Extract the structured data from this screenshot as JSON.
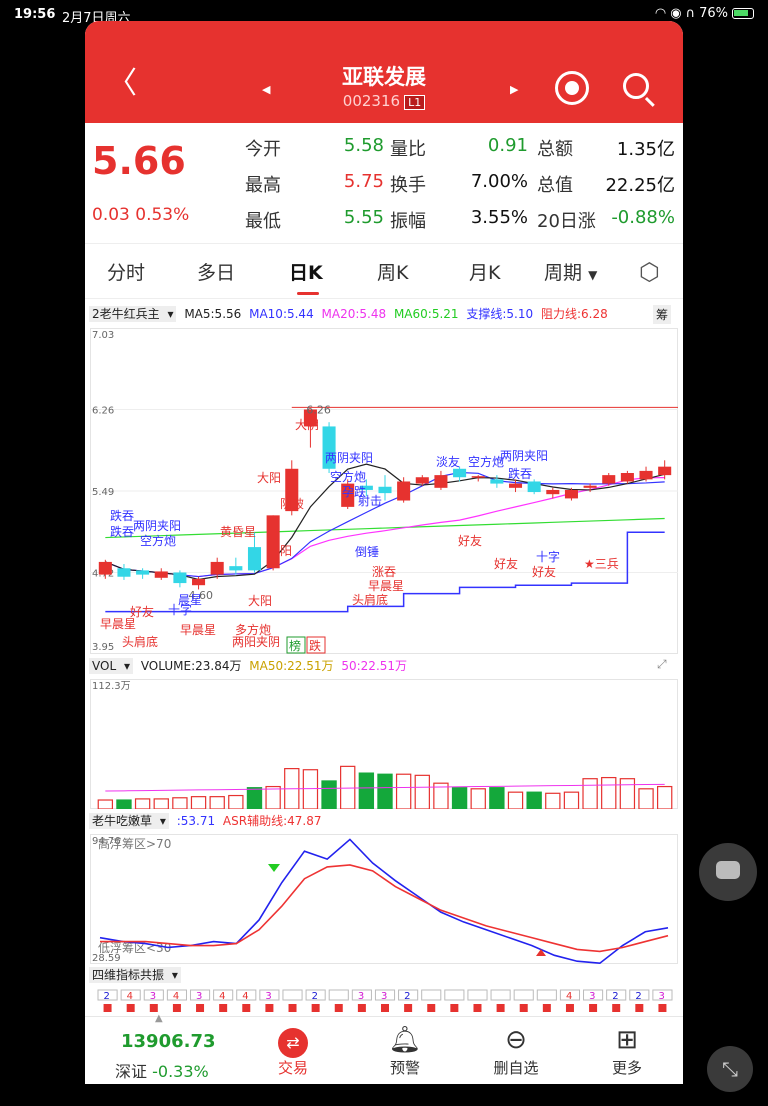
{
  "status": {
    "time": "19:56",
    "date": "2月7日周六",
    "battery": "76%"
  },
  "header": {
    "title": "亚联发展",
    "code": "002316",
    "level": "L1"
  },
  "quote": {
    "price": "5.66",
    "change": "0.03",
    "change_pct": "0.53%",
    "fields": [
      {
        "label": "今开",
        "value": "5.58",
        "color": "green"
      },
      {
        "label": "量比",
        "value": "0.91",
        "color": "green"
      },
      {
        "label": "总额",
        "value": "1.35亿",
        "color": "black"
      },
      {
        "label": "最高",
        "value": "5.75",
        "color": "red"
      },
      {
        "label": "换手",
        "value": "7.00%",
        "color": "black"
      },
      {
        "label": "总值",
        "value": "22.25亿",
        "color": "black"
      },
      {
        "label": "最低",
        "value": "5.55",
        "color": "green"
      },
      {
        "label": "振幅",
        "value": "3.55%",
        "color": "black"
      },
      {
        "label": "20日涨",
        "value": "-0.88%",
        "color": "green"
      }
    ]
  },
  "tabs": [
    "分时",
    "多日",
    "日K",
    "周K",
    "月K",
    "周期"
  ],
  "main_indicator": {
    "name": "2老牛红兵主",
    "ma5": "MA5:5.56",
    "ma10": "MA10:5.44",
    "ma20": "MA20:5.48",
    "ma60": "MA60:5.21",
    "support": "支撑线:5.10",
    "resist": "阻力线:6.28",
    "badge": "筹"
  },
  "price_axis": [
    "7.03",
    "6.26",
    "5.49",
    "4.72",
    "3.95"
  ],
  "colors": {
    "up": "#e6322f",
    "down": "#14a83b",
    "down_alt": "#33d6e6",
    "ma5": "#222222",
    "ma10": "#3333ff",
    "ma20": "#ff33ff",
    "ma60": "#33dd33"
  },
  "chart_data": [
    {
      "type": "candlestick",
      "title": "",
      "ylim": [
        3.95,
        7.03
      ],
      "candles": [
        {
          "o": 4.7,
          "c": 4.82,
          "h": 4.84,
          "l": 4.66,
          "t": "up"
        },
        {
          "o": 4.76,
          "c": 4.68,
          "h": 4.8,
          "l": 4.65,
          "t": "dn2"
        },
        {
          "o": 4.74,
          "c": 4.7,
          "h": 4.76,
          "l": 4.66,
          "t": "dn2"
        },
        {
          "o": 4.73,
          "c": 4.67,
          "h": 4.76,
          "l": 4.65,
          "t": "up"
        },
        {
          "o": 4.72,
          "c": 4.62,
          "h": 4.74,
          "l": 4.58,
          "t": "dn2"
        },
        {
          "o": 4.66,
          "c": 4.6,
          "h": 4.68,
          "l": 4.56,
          "t": "up"
        },
        {
          "o": 4.7,
          "c": 4.82,
          "h": 4.86,
          "l": 4.66,
          "t": "up"
        },
        {
          "o": 4.78,
          "c": 4.74,
          "h": 4.86,
          "l": 4.7,
          "t": "dn2"
        },
        {
          "o": 4.96,
          "c": 4.74,
          "h": 5.1,
          "l": 4.72,
          "t": "dn2"
        },
        {
          "o": 4.76,
          "c": 5.26,
          "h": 5.26,
          "l": 4.74,
          "t": "up"
        },
        {
          "o": 5.3,
          "c": 5.7,
          "h": 5.78,
          "l": 5.26,
          "t": "up"
        },
        {
          "o": 6.1,
          "c": 6.26,
          "h": 6.26,
          "l": 5.9,
          "t": "up"
        },
        {
          "o": 6.1,
          "c": 5.7,
          "h": 6.14,
          "l": 5.66,
          "t": "dn2"
        },
        {
          "o": 5.34,
          "c": 5.56,
          "h": 5.6,
          "l": 5.32,
          "t": "up"
        },
        {
          "o": 5.54,
          "c": 5.5,
          "h": 5.6,
          "l": 5.44,
          "t": "dn2"
        },
        {
          "o": 5.53,
          "c": 5.47,
          "h": 5.64,
          "l": 5.4,
          "t": "dn2"
        },
        {
          "o": 5.4,
          "c": 5.58,
          "h": 5.62,
          "l": 5.38,
          "t": "up"
        },
        {
          "o": 5.56,
          "c": 5.62,
          "h": 5.64,
          "l": 5.54,
          "t": "up"
        },
        {
          "o": 5.52,
          "c": 5.64,
          "h": 5.68,
          "l": 5.5,
          "t": "up"
        },
        {
          "o": 5.7,
          "c": 5.62,
          "h": 5.72,
          "l": 5.58,
          "t": "dn2"
        },
        {
          "o": 5.63,
          "c": 5.62,
          "h": 5.64,
          "l": 5.58,
          "t": "up"
        },
        {
          "o": 5.6,
          "c": 5.56,
          "h": 5.64,
          "l": 5.52,
          "t": "dn2"
        },
        {
          "o": 5.56,
          "c": 5.52,
          "h": 5.6,
          "l": 5.48,
          "t": "up"
        },
        {
          "o": 5.58,
          "c": 5.48,
          "h": 5.6,
          "l": 5.46,
          "t": "dn2"
        },
        {
          "o": 5.5,
          "c": 5.46,
          "h": 5.52,
          "l": 5.42,
          "t": "up"
        },
        {
          "o": 5.42,
          "c": 5.5,
          "h": 5.52,
          "l": 5.4,
          "t": "up"
        },
        {
          "o": 5.52,
          "c": 5.54,
          "h": 5.56,
          "l": 5.48,
          "t": "up"
        },
        {
          "o": 5.56,
          "c": 5.64,
          "h": 5.66,
          "l": 5.54,
          "t": "up"
        },
        {
          "o": 5.58,
          "c": 5.66,
          "h": 5.68,
          "l": 5.56,
          "t": "up"
        },
        {
          "o": 5.6,
          "c": 5.68,
          "h": 5.72,
          "l": 5.58,
          "t": "up"
        },
        {
          "o": 5.64,
          "c": 5.72,
          "h": 5.78,
          "l": 5.6,
          "t": "up"
        }
      ]
    },
    {
      "type": "bar",
      "title": "VOLUME:23.84万",
      "ylim": [
        0,
        112.3
      ],
      "values": [
        8,
        8,
        9,
        9,
        10,
        11,
        11,
        12,
        19,
        20,
        36,
        35,
        25,
        38,
        32,
        31,
        31,
        30,
        23,
        19,
        18,
        19,
        15,
        15,
        14,
        15,
        27,
        28,
        27,
        18,
        20
      ],
      "colors": [
        "up",
        "dn",
        "up",
        "up",
        "up",
        "up",
        "up",
        "up",
        "dn",
        "up",
        "up",
        "up",
        "dn",
        "up",
        "dn",
        "dn",
        "up",
        "up",
        "up",
        "dn",
        "up",
        "dn",
        "up",
        "dn",
        "up",
        "up",
        "up",
        "up",
        "up",
        "up",
        "up"
      ]
    },
    {
      "type": "line",
      "title": "ASR",
      "ylim": [
        28.59,
        94.76
      ],
      "series": [
        {
          "name": "ASR",
          "values": [
            42,
            40,
            39,
            37,
            38,
            40,
            39,
            51,
            70,
            86,
            82,
            92,
            80,
            71,
            63,
            55,
            50,
            46,
            42,
            38,
            33,
            30,
            29,
            38,
            45,
            47
          ]
        },
        {
          "name": "ASR辅助线",
          "values": [
            40,
            40,
            40,
            39,
            38,
            38,
            39,
            46,
            58,
            72,
            78,
            79,
            76,
            68,
            62,
            56,
            52,
            48,
            45,
            42,
            39,
            36,
            35,
            37,
            40,
            43
          ]
        }
      ]
    }
  ],
  "annotations": {
    "high": "6.26",
    "low": "4.60",
    "red_labels": [
      {
        "t": "大阴"
      },
      {
        "t": "二"
      },
      {
        "t": "阴破"
      },
      {
        "t": "大阳"
      },
      {
        "t": "一阳"
      },
      {
        "t": "大阳"
      },
      {
        "t": "好友"
      },
      {
        "t": "早晨星"
      },
      {
        "t": "头肩底"
      },
      {
        "t": "早晨星"
      },
      {
        "t": "多方炮"
      },
      {
        "t": "两阳夹阴"
      },
      {
        "t": "黄昏星"
      },
      {
        "t": "好友"
      },
      {
        "t": "涨吞"
      },
      {
        "t": "早晨星"
      },
      {
        "t": "头肩底"
      },
      {
        "t": "好友"
      },
      {
        "t": "好友"
      },
      {
        "t": "★三兵"
      }
    ],
    "blue_labels": [
      {
        "t": "两阴夹阳"
      },
      {
        "t": "空方炮"
      },
      {
        "t": "孕跌"
      },
      {
        "t": "射击"
      },
      {
        "t": "跌吞"
      },
      {
        "t": "两阴夹阳"
      },
      {
        "t": "跌吞"
      },
      {
        "t": "空方炮"
      },
      {
        "t": "倒锤"
      },
      {
        "t": "淡友"
      },
      {
        "t": "空方炮"
      },
      {
        "t": "两阴夹阳"
      },
      {
        "t": "跌吞"
      },
      {
        "t": "十字"
      },
      {
        "t": "十字"
      },
      {
        "t": "晨星"
      }
    ],
    "boxes": [
      "榜",
      "跌"
    ]
  },
  "volume_indicator": {
    "name": "VOL",
    "volume": "VOLUME:23.84万",
    "ma50": "MA50:22.51万",
    "v50": "50:22.51万",
    "axis_top": "112.3万"
  },
  "asr_indicator": {
    "name": "老牛吃嫩草",
    "asr": ":53.71",
    "aux": "ASR辅助线:47.87",
    "axis_top": "94.76",
    "axis_bottom": "28.59",
    "high_zone": "高浮筹区>70",
    "low_zone": "低浮筹区<30"
  },
  "resonance": {
    "name": "四维指标共振",
    "digits": [
      "2",
      "4",
      "3",
      "4",
      "3",
      "4",
      "4",
      "3",
      "",
      "2",
      "",
      "3",
      "3",
      "2",
      "",
      "",
      "",
      "",
      "",
      "",
      "4",
      "3",
      "2",
      "2",
      "3"
    ]
  },
  "bottom_nav": {
    "index_value": "13906.73",
    "index_name": "深证",
    "index_change": "-0.33%",
    "items": [
      "交易",
      "预警",
      "删自选",
      "更多"
    ]
  }
}
